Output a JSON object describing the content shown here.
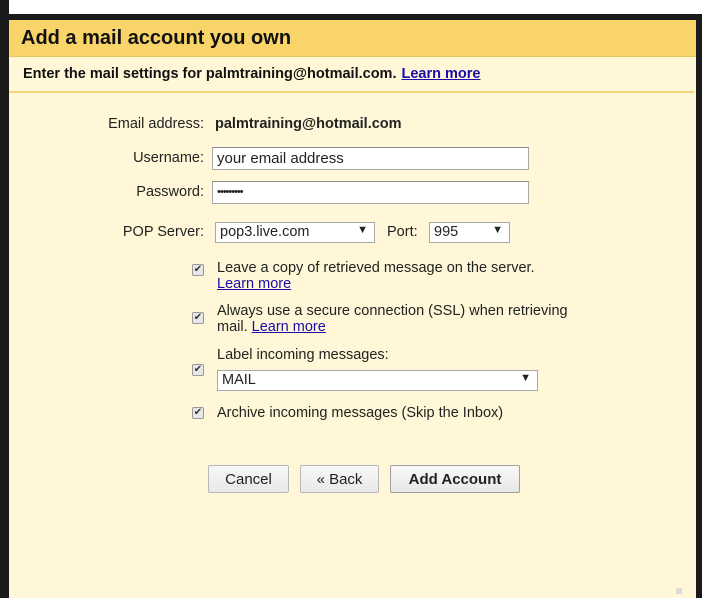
{
  "dialog": {
    "title": "Add a mail account you own",
    "subtitle": "Enter the mail settings for palmtraining@hotmail.com.",
    "subtitle_link": "Learn more"
  },
  "form": {
    "email_label": "Email address:",
    "email_value": "palmtraining@hotmail.com",
    "username_label": "Username:",
    "username_value": "your email address",
    "password_label": "Password:",
    "password_value": "•••••••••",
    "pop_label": "POP Server:",
    "pop_value": "pop3.live.com",
    "port_label": "Port:",
    "port_value": "995"
  },
  "options": {
    "leave_copy_text": "Leave a copy of retrieved message on the server.",
    "leave_copy_link": "Learn more",
    "leave_copy_checked": true,
    "ssl_text_line1": "Always use a secure connection (SSL) when retrieving",
    "ssl_text_line2": "mail.",
    "ssl_link": "Learn more",
    "ssl_checked": true,
    "label_text": "Label incoming messages:",
    "label_checked": true,
    "label_select_value": "MAIL",
    "archive_text": "Archive incoming messages (Skip the Inbox)",
    "archive_checked": true
  },
  "buttons": {
    "cancel": "Cancel",
    "back": "« Back",
    "add": "Add Account"
  },
  "icons": {
    "check": "✔",
    "dropdown_arrow": "▼"
  }
}
